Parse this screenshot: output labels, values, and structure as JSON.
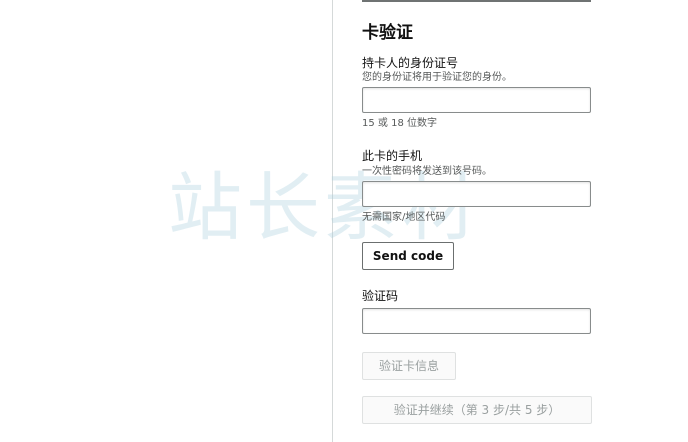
{
  "watermark": {
    "text": "站长素材"
  },
  "section": {
    "title": "卡验证"
  },
  "id_field": {
    "label": "持卡人的身份证号",
    "hint": "您的身份证将用于验证您的身份。",
    "value": "",
    "note": "15 或 18 位数字"
  },
  "phone_field": {
    "label": "此卡的手机",
    "hint": "一次性密码将发送到该号码。",
    "value": "",
    "note": "无需国家/地区代码"
  },
  "send_code_button": {
    "label": "Send code"
  },
  "code_field": {
    "label": "验证码",
    "value": ""
  },
  "verify_card_button": {
    "label": "验证卡信息"
  },
  "continue_button": {
    "label": "验证并继续（第 3 步/共 5 步）"
  }
}
